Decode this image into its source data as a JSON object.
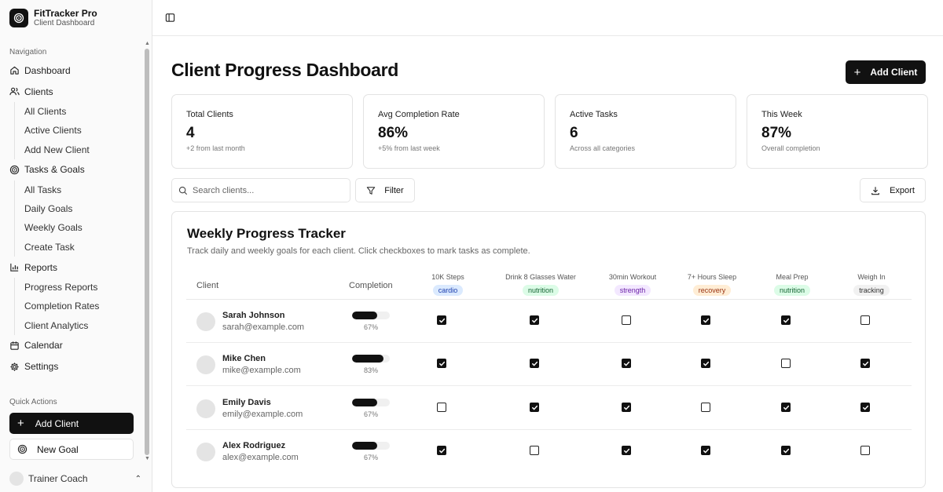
{
  "brand": {
    "name": "FitTracker Pro",
    "subtitle": "Client Dashboard"
  },
  "nav": {
    "label": "Navigation",
    "dashboard": "Dashboard",
    "clients": {
      "label": "Clients",
      "items": [
        "All Clients",
        "Active Clients",
        "Add New Client"
      ]
    },
    "tasks": {
      "label": "Tasks & Goals",
      "items": [
        "All Tasks",
        "Daily Goals",
        "Weekly Goals",
        "Create Task"
      ]
    },
    "reports": {
      "label": "Reports",
      "items": [
        "Progress Reports",
        "Completion Rates",
        "Client Analytics"
      ]
    },
    "calendar": "Calendar",
    "settings": "Settings"
  },
  "quick_actions": {
    "label": "Quick Actions",
    "add_client": "Add Client",
    "new_goal": "New Goal"
  },
  "user": {
    "name": "Trainer Coach"
  },
  "page": {
    "title": "Client Progress Dashboard",
    "add_client": "Add Client"
  },
  "stats": [
    {
      "label": "Total Clients",
      "value": "4",
      "sub": "+2 from last month"
    },
    {
      "label": "Avg Completion Rate",
      "value": "86%",
      "sub": "+5% from last week"
    },
    {
      "label": "Active Tasks",
      "value": "6",
      "sub": "Across all categories"
    },
    {
      "label": "This Week",
      "value": "87%",
      "sub": "Overall completion"
    }
  ],
  "toolbar": {
    "search_placeholder": "Search clients...",
    "filter": "Filter",
    "export": "Export"
  },
  "tracker": {
    "title": "Weekly Progress Tracker",
    "subtitle": "Track daily and weekly goals for each client. Click checkboxes to mark tasks as complete.",
    "col_client": "Client",
    "col_completion": "Completion",
    "tasks": [
      {
        "name": "10K Steps",
        "category": "cardio"
      },
      {
        "name": "Drink 8 Glasses Water",
        "category": "nutrition"
      },
      {
        "name": "30min Workout",
        "category": "strength"
      },
      {
        "name": "7+ Hours Sleep",
        "category": "recovery"
      },
      {
        "name": "Meal Prep",
        "category": "nutrition"
      },
      {
        "name": "Weigh In",
        "category": "tracking"
      }
    ],
    "clients": [
      {
        "name": "Sarah Johnson",
        "email": "sarah@example.com",
        "completion": "67%",
        "progress": 0.67,
        "done": [
          true,
          true,
          false,
          true,
          true,
          false
        ]
      },
      {
        "name": "Mike Chen",
        "email": "mike@example.com",
        "completion": "83%",
        "progress": 0.83,
        "done": [
          true,
          true,
          true,
          true,
          false,
          true
        ]
      },
      {
        "name": "Emily Davis",
        "email": "emily@example.com",
        "completion": "67%",
        "progress": 0.67,
        "done": [
          false,
          true,
          true,
          false,
          true,
          true
        ]
      },
      {
        "name": "Alex Rodriguez",
        "email": "alex@example.com",
        "completion": "67%",
        "progress": 0.67,
        "done": [
          true,
          false,
          true,
          true,
          true,
          false
        ]
      }
    ]
  },
  "colors": {
    "cardio": "#dbeafe",
    "cardio_text": "#1e40af",
    "nutrition": "#dcfce7",
    "nutrition_text": "#166534",
    "strength": "#f3e8ff",
    "strength_text": "#6b21a8",
    "recovery": "#ffedd5",
    "recovery_text": "#9a3412",
    "tracking": "#f1f1f1",
    "tracking_text": "#333333"
  }
}
